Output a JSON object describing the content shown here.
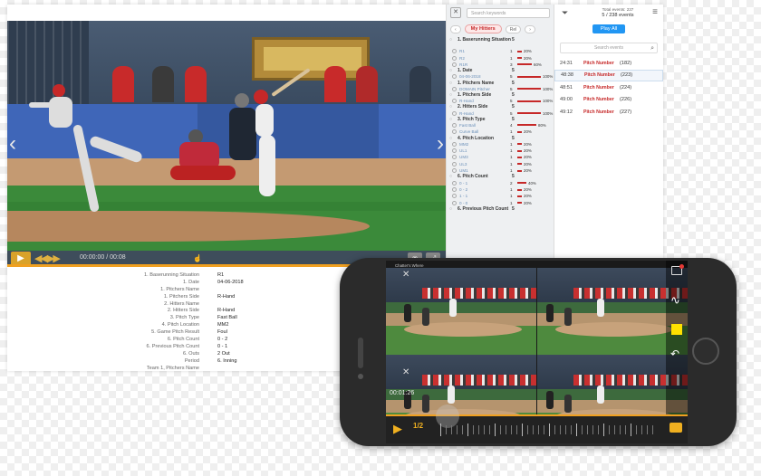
{
  "desktop": {
    "timecode": "00:00:00 / 00:08",
    "details": [
      {
        "label": "1. Baserunning Situation",
        "value": "R1"
      },
      {
        "label": "1. Date",
        "value": "04-06-2018"
      },
      {
        "label": "1. Pitchers Name",
        "value": ""
      },
      {
        "label": "1. Pitchers Side",
        "value": "R-Hand"
      },
      {
        "label": "2. Hitters Name",
        "value": ""
      },
      {
        "label": "2. Hitters Side",
        "value": "R-Hand"
      },
      {
        "label": "3. Pitch Type",
        "value": "Fast Ball"
      },
      {
        "label": "4. Pitch Location",
        "value": "MM2"
      },
      {
        "label": "5. Game Pitch Result",
        "value": "Foul"
      },
      {
        "label": "6. Pitch Count",
        "value": "0 - 2"
      },
      {
        "label": "6. Previous Pitch Count",
        "value": "0 - 1"
      },
      {
        "label": "6. Outs",
        "value": "2 Out"
      },
      {
        "label": "Period",
        "value": "6. Inning"
      },
      {
        "label": "Team 1, Pitchers Name",
        "value": ""
      }
    ]
  },
  "filters": {
    "search_placeholder": "Search keywords",
    "active_pill": "My Hitters",
    "pill_small_1": "Rel",
    "pill_small_2": "",
    "groups": [
      {
        "title": "1. Baserunning Situation",
        "count": "5",
        "items": [
          {
            "name": "R1",
            "count": "1",
            "pct": "20%",
            "fill": 0.2
          },
          {
            "name": "R2",
            "count": "1",
            "pct": "20%",
            "fill": 0.2
          },
          {
            "name": "R1R",
            "count": "3",
            "pct": "60%",
            "fill": 0.6
          }
        ]
      },
      {
        "title": "1. Date",
        "count": "5",
        "items": [
          {
            "name": "04-06-2018",
            "count": "5",
            "pct": "100%",
            "fill": 1.0
          }
        ]
      },
      {
        "title": "1. Pitchers Name",
        "count": "5",
        "items": [
          {
            "name": "DOMAIN Pitcher",
            "count": "5",
            "pct": "100%",
            "fill": 1.0
          }
        ]
      },
      {
        "title": "1. Pitchers Side",
        "count": "5",
        "items": [
          {
            "name": "R-Hand",
            "count": "5",
            "pct": "100%",
            "fill": 1.0
          }
        ]
      },
      {
        "title": "2. Hitters Side",
        "count": "5",
        "items": [
          {
            "name": "R-Hand",
            "count": "5",
            "pct": "100%",
            "fill": 1.0
          }
        ]
      },
      {
        "title": "3. Pitch Type",
        "count": "5",
        "items": [
          {
            "name": "Fast Ball",
            "count": "4",
            "pct": "80%",
            "fill": 0.8
          },
          {
            "name": "Curve Ball",
            "count": "1",
            "pct": "20%",
            "fill": 0.2
          }
        ]
      },
      {
        "title": "4. Pitch Location",
        "count": "5",
        "items": [
          {
            "name": "MM2",
            "count": "1",
            "pct": "20%",
            "fill": 0.2
          },
          {
            "name": "UL1",
            "count": "1",
            "pct": "20%",
            "fill": 0.2
          },
          {
            "name": "UM3",
            "count": "1",
            "pct": "20%",
            "fill": 0.2
          },
          {
            "name": "UL3",
            "count": "1",
            "pct": "20%",
            "fill": 0.2
          },
          {
            "name": "UM1",
            "count": "1",
            "pct": "20%",
            "fill": 0.2
          }
        ]
      },
      {
        "title": "6. Pitch Count",
        "count": "5",
        "items": [
          {
            "name": "0 - 1",
            "count": "2",
            "pct": "40%",
            "fill": 0.4
          },
          {
            "name": "0 - 2",
            "count": "1",
            "pct": "20%",
            "fill": 0.2
          },
          {
            "name": "1 - 1",
            "count": "1",
            "pct": "20%",
            "fill": 0.2
          },
          {
            "name": "0 - 0",
            "count": "1",
            "pct": "20%",
            "fill": 0.2
          }
        ]
      },
      {
        "title": "6. Previous Pitch Count",
        "count": "5",
        "items": []
      }
    ]
  },
  "events": {
    "total_label": "Total events: 237",
    "count_label": "5 / 238 events",
    "play_all": "Play All",
    "search_placeholder": "Search events",
    "rows": [
      {
        "time": "24:31",
        "label": "Pitch Number",
        "num": "(182)",
        "active": false
      },
      {
        "time": "48:38",
        "label": "Pitch Number",
        "num": "(223)",
        "active": true
      },
      {
        "time": "48:51",
        "label": "Pitch Number",
        "num": "(224)",
        "active": false
      },
      {
        "time": "49:00",
        "label": "Pitch Number",
        "num": "(226)",
        "active": false
      },
      {
        "time": "49:12",
        "label": "Pitch Number",
        "num": "(227)",
        "active": false
      }
    ]
  },
  "phone": {
    "title": "Chatter's Where",
    "time": "00:01:26",
    "speed": "1/2"
  },
  "colors": {
    "accent_orange": "#f0a020",
    "hitter_red": "#c62828",
    "play_blue": "#2196f3",
    "draw_yellow": "#ffe000"
  }
}
